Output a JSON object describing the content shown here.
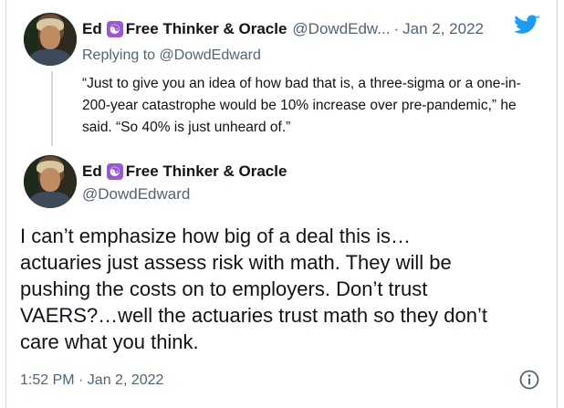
{
  "reply_tweet": {
    "display_name": "Ed",
    "badge_icon": "yin-yang-icon",
    "name_suffix": "Free Thinker & Oracle",
    "handle": "@DowdEdw...",
    "separator": "·",
    "date": "Jan 2, 2022",
    "replying_prefix": "Replying to",
    "replying_handle": "@DowdEdward",
    "text": "“Just to give you an idea of how bad that is, a three-sigma or a one-in-200-year catastrophe would be 10% increase over pre-pandemic,” he said. “So 40% is just unheard of.”"
  },
  "main_tweet": {
    "display_name": "Ed",
    "badge_icon": "yin-yang-icon",
    "name_suffix": "Free Thinker & Oracle",
    "handle": "@DowdEdward",
    "text": "I can’t emphasize how big of a deal this is…\nactuaries just assess risk with math. They will be\npushing the costs on to employers.  Don’t trust\nVAERS?…well the actuaries trust math so they don’t\ncare what you think.",
    "timestamp": "1:52 PM · Jan 2, 2022"
  },
  "colors": {
    "twitter_blue": "#1d9bf0",
    "secondary_text": "#536471",
    "badge_purple": "#9b59d0",
    "border": "#cfd9de"
  }
}
